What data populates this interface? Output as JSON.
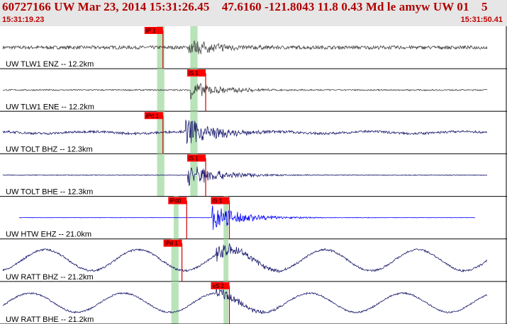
{
  "header": {
    "title": "60727166 UW Mar 23, 2014 15:31:26.45    47.6160 -121.8043 11.8 0.43 Md le amyw UW 01    5",
    "time_start": "15:31:19.23",
    "time_end": "15:31:50.41"
  },
  "colors": {
    "pick_box": "#ff0000",
    "pick_line": "#cc0000",
    "window_green": "#b9e3b9",
    "trace_default": "#444444",
    "trace_dark": "#1a1a6e",
    "trace_blue": "#0000ff"
  },
  "traces": [
    {
      "label": "UW TLW1 ENZ -- 12.2km",
      "color": "dark",
      "picks": [
        {
          "text": "iP 1",
          "t": 0.3
        }
      ],
      "onset": 0.39,
      "noise": 0.18,
      "amp": 0.45,
      "drift": 0
    },
    {
      "label": "UW TLW1 ENE -- 12.2km",
      "color": "dark",
      "picks": [
        {
          "text": "iS 1",
          "t": 0.39
        }
      ],
      "onset": 0.395,
      "noise": 0.07,
      "amp": 0.5,
      "drift": 0
    },
    {
      "label": "UW TOLT BHZ -- 12.3km",
      "color": "navy",
      "picks": [
        {
          "text": "iPd 1",
          "t": 0.3
        }
      ],
      "onset": 0.385,
      "noise": 0.12,
      "amp": 0.75,
      "drift": 0.05
    },
    {
      "label": "UW TOLT BHE -- 12.3km",
      "color": "navy",
      "picks": [
        {
          "text": "iS 1",
          "t": 0.39
        }
      ],
      "onset": 0.39,
      "noise": 0.04,
      "amp": 0.65,
      "drift": 0
    },
    {
      "label": "UW HTW EHZ -- 21.0km",
      "color": "blue",
      "picks": [
        {
          "text": "iPd0",
          "t": 0.35
        },
        {
          "text": "iS 1",
          "t": 0.44
        }
      ],
      "onset": 0.44,
      "noise": 0.02,
      "amp": 0.7,
      "drift": 0
    },
    {
      "label": "UW RATT BHZ -- 21.2km",
      "color": "navy",
      "picks": [
        {
          "text": "iPd 1",
          "t": 0.34
        }
      ],
      "onset": 0.45,
      "noise": 0.1,
      "amp": 0.45,
      "drift": 0.55
    },
    {
      "label": "UW RATT BHE -- 21.2km",
      "color": "navy",
      "picks": [
        {
          "text": "eS 2",
          "t": 0.44
        }
      ],
      "onset": 0.45,
      "noise": 0.08,
      "amp": 0.3,
      "drift": 0.5
    }
  ]
}
